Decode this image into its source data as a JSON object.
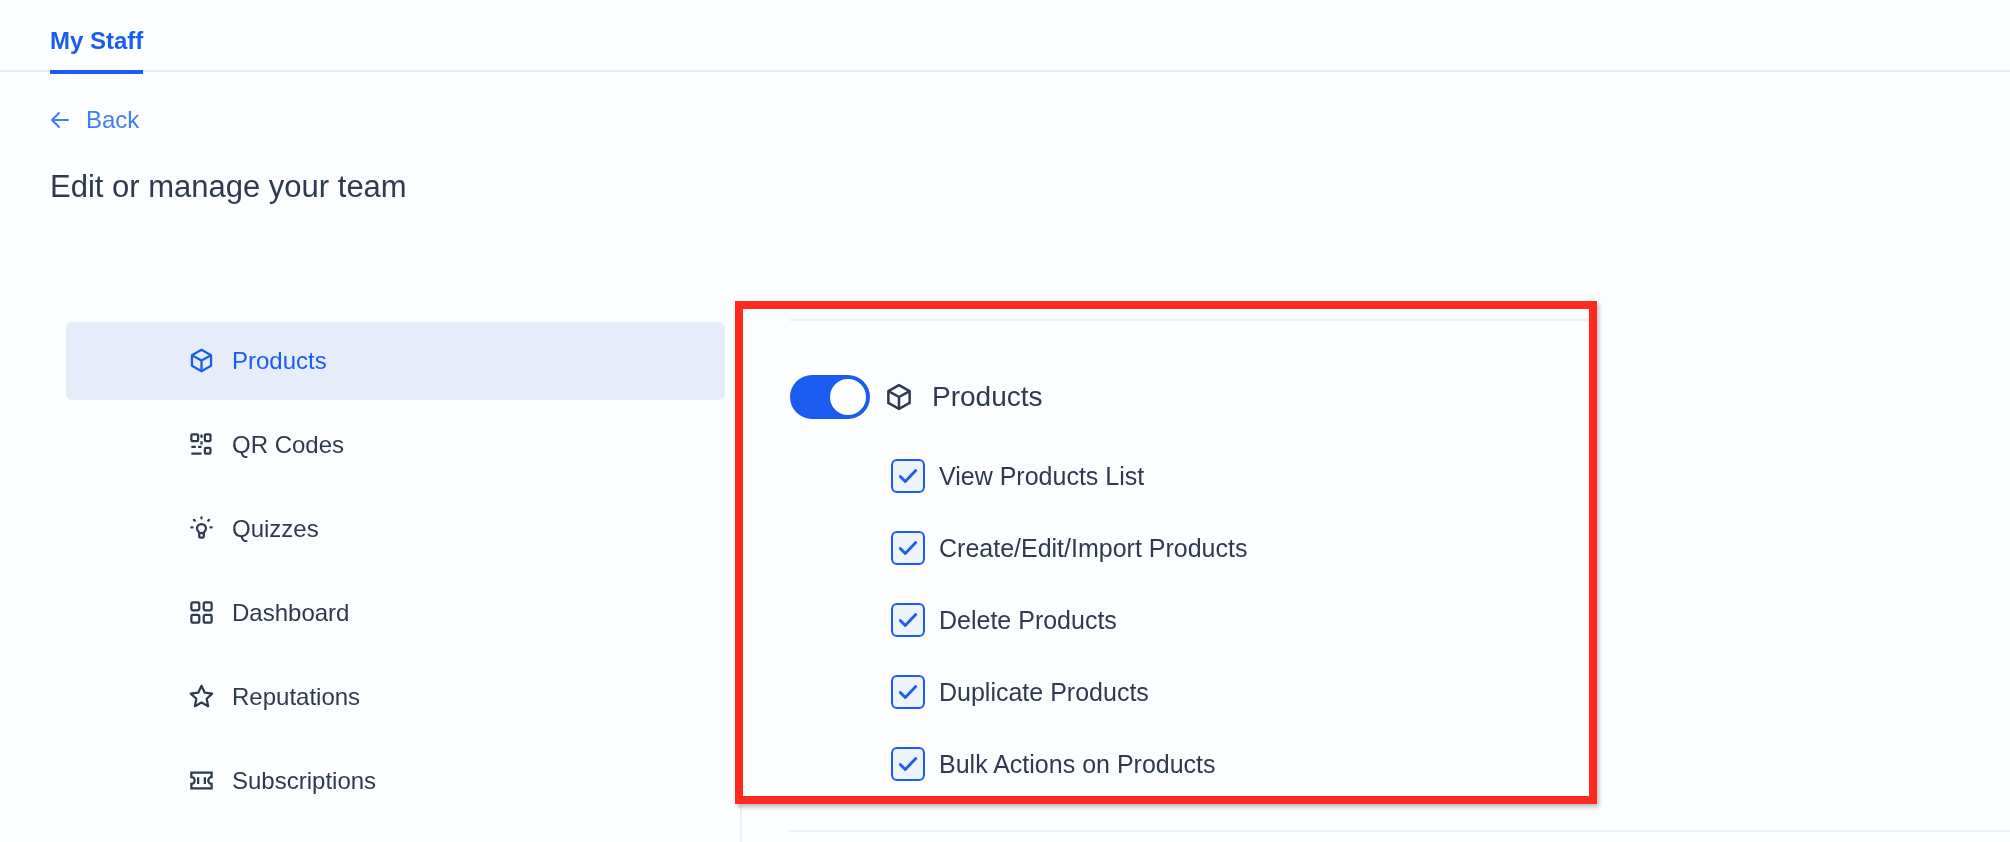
{
  "tabs": [
    {
      "label": "My Staff",
      "selected": true
    }
  ],
  "back_link": {
    "label": "Back"
  },
  "heading": "Edit or manage your team",
  "sidebar": {
    "items": [
      {
        "label": "Products",
        "kind": "box",
        "selected": true
      },
      {
        "label": "QR Codes",
        "kind": "qr",
        "selected": false
      },
      {
        "label": "Quizzes",
        "kind": "bulb",
        "selected": false
      },
      {
        "label": "Dashboard",
        "kind": "grid",
        "selected": false
      },
      {
        "label": "Reputations",
        "kind": "star",
        "selected": false
      },
      {
        "label": "Subscriptions",
        "kind": "ticket",
        "selected": false
      }
    ]
  },
  "permission_group": {
    "title": "Products",
    "on": true,
    "permissions": [
      {
        "label": "View Products List",
        "checked": true
      },
      {
        "label": "Create/Edit/Import Products",
        "checked": true
      },
      {
        "label": "Delete Products",
        "checked": true
      },
      {
        "label": "Duplicate Products",
        "checked": true
      },
      {
        "label": "Bulk Actions on Products",
        "checked": true
      }
    ]
  }
}
